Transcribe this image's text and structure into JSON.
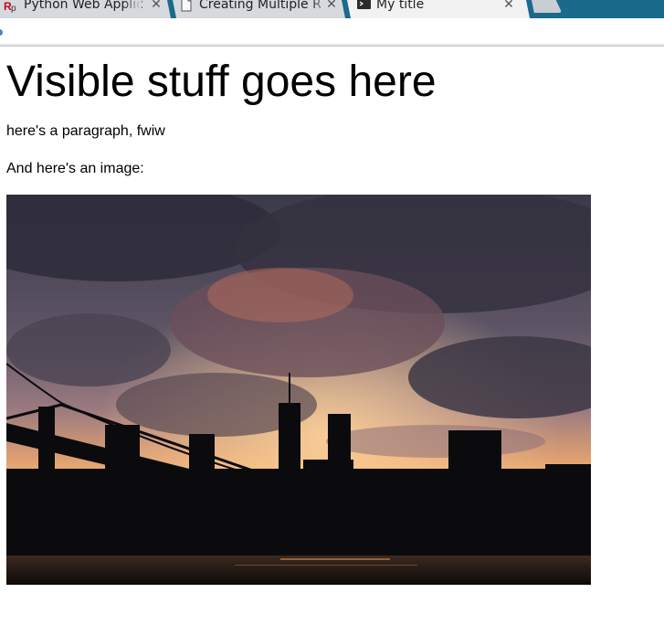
{
  "browser": {
    "tabs": [
      {
        "title": "Python Web Applic",
        "icon": "rp-favicon-icon",
        "active": false
      },
      {
        "title": "Creating Multiple R",
        "icon": "document-icon",
        "active": false
      },
      {
        "title": "My title",
        "icon": "terminal-icon",
        "active": true
      }
    ],
    "close_glyph": "✕",
    "colors": {
      "tabstrip": "#1a6a8c",
      "tab_inactive": "#d6d9dd",
      "tab_active": "#f2f2f2"
    }
  },
  "page": {
    "heading": "Visible stuff goes here",
    "paragraph": "here's a paragraph, fwiw",
    "image_intro": "And here's an image:",
    "image_icon": "city-skyline-sunset-image"
  }
}
